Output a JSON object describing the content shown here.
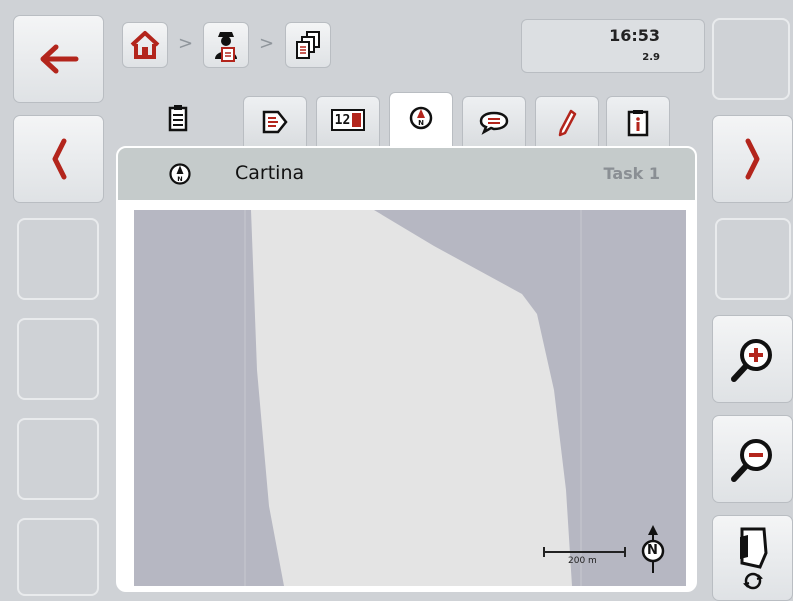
{
  "status": {
    "time": "16:53",
    "version": "2.9"
  },
  "breadcrumb": {
    "items": [
      {
        "icon": "home-icon"
      },
      {
        "icon": "farmer-contact-icon"
      },
      {
        "icon": "task-copy-icon"
      }
    ],
    "separator": ">"
  },
  "tabs": [
    {
      "icon": "clipboard-icon",
      "active": false
    },
    {
      "icon": "workflow-icon",
      "active": false
    },
    {
      "icon": "counters-icon",
      "label": "12",
      "active": false
    },
    {
      "icon": "map-compass-icon",
      "active": true
    },
    {
      "icon": "comment-icon",
      "active": false
    },
    {
      "icon": "pencil-icon",
      "active": false
    },
    {
      "icon": "info-icon",
      "active": false
    }
  ],
  "panel": {
    "title": "Cartina",
    "task": "Task 1"
  },
  "map": {
    "scale_label": "200 m",
    "north_label": "N",
    "colors": {
      "background": "#b6b7c2",
      "field": "#e4e4e4",
      "gridline": "#c8c9d0"
    }
  },
  "left_buttons": [
    "back-arrow-icon",
    "previous-page-icon"
  ],
  "right_buttons": [
    "next-page-icon",
    "zoom-in-icon",
    "zoom-out-icon",
    "map-orientation-icon"
  ],
  "colors": {
    "accent_red": "#b3251c",
    "background": "#cfd2d6",
    "header": "#c5cbcb"
  }
}
